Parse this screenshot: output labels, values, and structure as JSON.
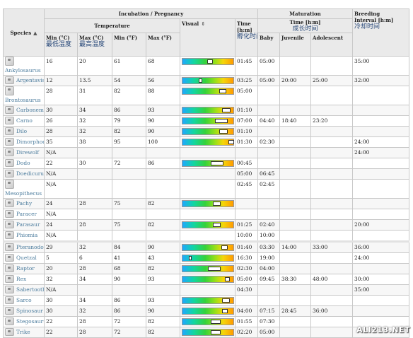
{
  "headers": {
    "species": "Species",
    "incubation": "Incubation / Pregnancy",
    "temperature": "Temperature",
    "min_c": "Min (°C)",
    "max_c": "Max (°C)",
    "min_f": "Min (°F)",
    "max_f": "Max (°F)",
    "visual": "Visual",
    "time": "Time [h:m]",
    "maturation": "Maturation",
    "mat_time": "Time [h:m]",
    "baby": "Baby",
    "juvenile": "Juvenile",
    "adolescent": "Adolescent",
    "breeding": "Breeding Interval [h:m]"
  },
  "annotations": {
    "min_temp": "最低温度",
    "max_temp": "最高温度",
    "hatch_time": "孵化时间",
    "growth_time": "成长时间",
    "cooldown": "冷却时间"
  },
  "rows": [
    {
      "name": "Ankylosaurus",
      "minC": "16",
      "maxC": "20",
      "minF": "61",
      "maxF": "68",
      "bar": {
        "s": 0.48,
        "e": 0.57
      },
      "time": "01:45",
      "baby": "05:00",
      "juv": "",
      "ado": "",
      "breed": "35:00",
      "tall": true
    },
    {
      "name": "Argentavis",
      "minC": "12",
      "maxC": "13.5",
      "minF": "54",
      "maxF": "56",
      "bar": {
        "s": 0.32,
        "e": 0.36
      },
      "time": "03:25",
      "baby": "05:00",
      "juv": "20:00",
      "ado": "25:00",
      "breed": "32:00"
    },
    {
      "name": "Brontosaurus",
      "minC": "28",
      "maxC": "31",
      "minF": "82",
      "maxF": "88",
      "bar": {
        "s": 0.72,
        "e": 0.84
      },
      "time": "05:00",
      "baby": "",
      "juv": "",
      "ado": "",
      "breed": "",
      "tall": true
    },
    {
      "name": "Carbonemys",
      "minC": "30",
      "maxC": "34",
      "minF": "86",
      "maxF": "93",
      "bar": {
        "s": 0.78,
        "e": 0.92
      },
      "time": "01:10",
      "baby": "",
      "juv": "",
      "ado": "",
      "breed": ""
    },
    {
      "name": "Carno",
      "minC": "26",
      "maxC": "32",
      "minF": "79",
      "maxF": "90",
      "bar": {
        "s": 0.64,
        "e": 0.86
      },
      "time": "07:00",
      "baby": "04:40",
      "juv": "18:40",
      "ado": "23:20",
      "breed": ""
    },
    {
      "name": "Dilo",
      "minC": "28",
      "maxC": "32",
      "minF": "82",
      "maxF": "90",
      "bar": {
        "s": 0.72,
        "e": 0.86
      },
      "time": "01:10",
      "baby": "",
      "juv": "",
      "ado": "",
      "breed": ""
    },
    {
      "name": "Dimorphodon",
      "minC": "35",
      "maxC": "38",
      "minF": "95",
      "maxF": "100",
      "bar": {
        "s": 0.9,
        "e": 0.99
      },
      "time": "01:30",
      "baby": "02:30",
      "juv": "",
      "ado": "",
      "breed": "24:00"
    },
    {
      "name": "Direwolf",
      "minC": "N/A",
      "maxC": "",
      "minF": "",
      "maxF": "",
      "bar": null,
      "time": "",
      "baby": "",
      "juv": "",
      "ado": "",
      "breed": "24:00"
    },
    {
      "name": "Dodo",
      "minC": "22",
      "maxC": "30",
      "minF": "72",
      "maxF": "86",
      "bar": {
        "s": 0.55,
        "e": 0.78
      },
      "time": "00:45",
      "baby": "",
      "juv": "",
      "ado": "",
      "breed": ""
    },
    {
      "name": "Doedicurus",
      "minC": "N/A",
      "maxC": "",
      "minF": "",
      "maxF": "",
      "bar": null,
      "time": "05:00",
      "baby": "06:45",
      "juv": "",
      "ado": "",
      "breed": ""
    },
    {
      "name": "Mesopithecus",
      "minC": "N/A",
      "maxC": "",
      "minF": "",
      "maxF": "",
      "bar": null,
      "time": "02:45",
      "baby": "02:45",
      "juv": "",
      "ado": "",
      "breed": "",
      "tall": true
    },
    {
      "name": "Pachy",
      "minC": "24",
      "maxC": "28",
      "minF": "75",
      "maxF": "82",
      "bar": {
        "s": 0.6,
        "e": 0.72
      },
      "time": "",
      "baby": "",
      "juv": "",
      "ado": "",
      "breed": ""
    },
    {
      "name": "Paracer",
      "minC": "N/A",
      "maxC": "",
      "minF": "",
      "maxF": "",
      "bar": null,
      "time": "",
      "baby": "",
      "juv": "",
      "ado": "",
      "breed": ""
    },
    {
      "name": "Parasaur",
      "minC": "24",
      "maxC": "28",
      "minF": "75",
      "maxF": "82",
      "bar": {
        "s": 0.6,
        "e": 0.72
      },
      "time": "01:25",
      "baby": "02:40",
      "juv": "",
      "ado": "",
      "breed": "20:00"
    },
    {
      "name": "Phiomia",
      "minC": "N/A",
      "maxC": "",
      "minF": "",
      "maxF": "",
      "bar": null,
      "time": "10:00",
      "baby": "10:00",
      "juv": "",
      "ado": "",
      "breed": ""
    },
    {
      "name": "Pteranodon",
      "minC": "29",
      "maxC": "32",
      "minF": "84",
      "maxF": "90",
      "bar": {
        "s": 0.76,
        "e": 0.86
      },
      "time": "01:40",
      "baby": "03:30",
      "juv": "14:00",
      "ado": "33:00",
      "breed": "36:00",
      "gap": true
    },
    {
      "name": "Quetzal",
      "minC": "5",
      "maxC": "6",
      "minF": "41",
      "maxF": "43",
      "bar": {
        "s": 0.12,
        "e": 0.15
      },
      "time": "16:30",
      "baby": "19:00",
      "juv": "",
      "ado": "",
      "breed": "24:00"
    },
    {
      "name": "Raptor",
      "minC": "20",
      "maxC": "28",
      "minF": "68",
      "maxF": "82",
      "bar": {
        "s": 0.5,
        "e": 0.72
      },
      "time": "02:30",
      "baby": "04:00",
      "juv": "",
      "ado": "",
      "breed": ""
    },
    {
      "name": "Rex",
      "minC": "32",
      "maxC": "34",
      "minF": "90",
      "maxF": "93",
      "bar": {
        "s": 0.84,
        "e": 0.9
      },
      "time": "05:00",
      "baby": "09:45",
      "juv": "38:30",
      "ado": "48:00",
      "breed": "30:00"
    },
    {
      "name": "Sabertooth",
      "minC": "N/A",
      "maxC": "",
      "minF": "",
      "maxF": "",
      "bar": null,
      "time": "04:30",
      "baby": "",
      "juv": "",
      "ado": "",
      "breed": "35:00"
    },
    {
      "name": "Sarco",
      "minC": "30",
      "maxC": "34",
      "minF": "86",
      "maxF": "93",
      "bar": {
        "s": 0.78,
        "e": 0.9
      },
      "time": "",
      "baby": "",
      "juv": "",
      "ado": "",
      "breed": ""
    },
    {
      "name": "Spinosaur",
      "minC": "30",
      "maxC": "32",
      "minF": "86",
      "maxF": "90",
      "bar": {
        "s": 0.78,
        "e": 0.86
      },
      "time": "04:00",
      "baby": "07:15",
      "juv": "28:45",
      "ado": "36:00",
      "breed": ""
    },
    {
      "name": "Stegosaurus",
      "minC": "22",
      "maxC": "28",
      "minF": "72",
      "maxF": "82",
      "bar": {
        "s": 0.55,
        "e": 0.72
      },
      "time": "01:55",
      "baby": "07:30",
      "juv": "",
      "ado": "",
      "breed": ""
    },
    {
      "name": "Trike",
      "minC": "22",
      "maxC": "28",
      "minF": "72",
      "maxF": "82",
      "bar": {
        "s": 0.55,
        "e": 0.72
      },
      "time": "02:20",
      "baby": "05:00",
      "juv": "",
      "ado": "",
      "breed": ""
    }
  ],
  "watermark": "ALI213.NET"
}
